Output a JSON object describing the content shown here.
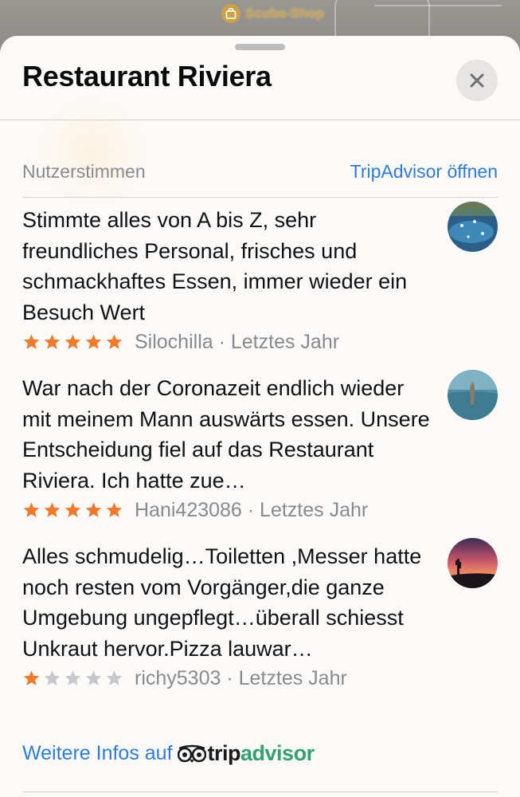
{
  "map": {
    "poi_label": "Scuba-Shop",
    "poi_icon": "shopping-bag-icon"
  },
  "sheet": {
    "title": "Restaurant Riviera",
    "close_icon": "close-icon"
  },
  "reviews_section": {
    "title": "Nutzerstimmen",
    "open_link": "TripAdvisor öffnen"
  },
  "reviews": [
    {
      "text": "Stimmte alles von A bis Z, sehr freundliches Personal, frisches und schmackhaftes Essen, immer wieder ein Besuch Wert",
      "rating": 5,
      "meta": "Silochilla · Letztes Jahr",
      "avatar": "sea-boats-photo"
    },
    {
      "text": "War nach der Coronazeit endlich wieder mit meinem Mann auswärts essen. Unsere Entscheidung fiel auf das Restaurant Riviera. Ich hatte zue…",
      "rating": 5,
      "meta": "Hani423086 · Letztes Jahr",
      "avatar": "water-photo"
    },
    {
      "text": "Alles schmudelig…Toiletten ,Messer hatte noch resten vom Vorgänger,die ganze Umgebung ungepflegt…überall schiesst Unkraut hervor.Pizza lauwar…",
      "rating": 1,
      "meta": "richy5303 · Letztes Jahr",
      "avatar": "sunset-cactus-photo"
    }
  ],
  "footer": {
    "link_text": "Weitere Infos auf",
    "brand_part1": "trip",
    "brand_part2": "advisor",
    "brand_icon": "tripadvisor-owl-icon"
  },
  "colors": {
    "accent": "#2f7bd8",
    "star_filled": "#ef7a2e",
    "star_empty": "#c7c7cc",
    "tripadvisor_green": "#34a06d"
  }
}
